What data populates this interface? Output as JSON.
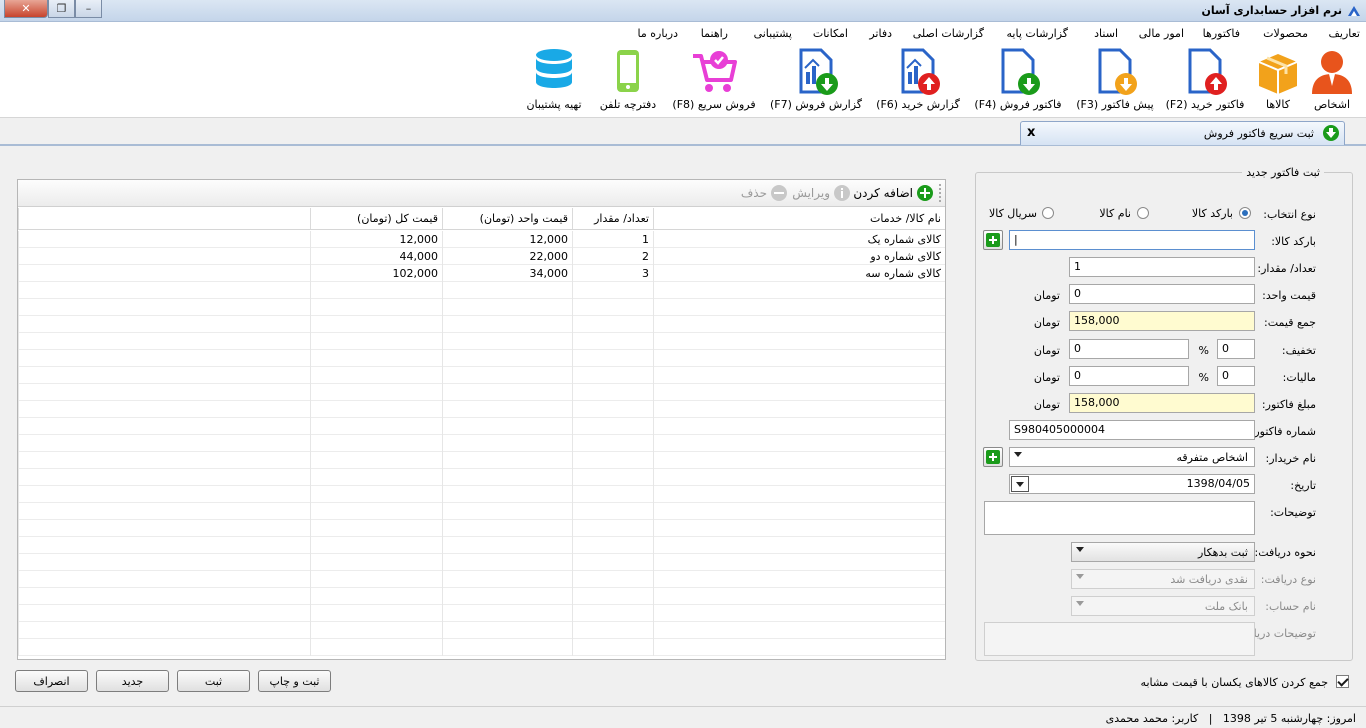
{
  "window": {
    "title": "نرم افزار حسابداری آسان"
  },
  "menu": [
    "تعاریف",
    "محصولات",
    "فاکتورها",
    "امور مالی",
    "اسناد",
    "گزارشات پایه",
    "گزارشات اصلی",
    "دفاتر",
    "امکانات",
    "پشتیبانی",
    "راهنما",
    "درباره ما"
  ],
  "toolbar": {
    "people": "اشخاص",
    "products": "کالاها",
    "purchase": "فاکتور خرید (F2)",
    "proforma": "پیش فاکتور (F3)",
    "sales": "فاکتور فروش (F4)",
    "purchase_report": "گزارش خرید (F6)",
    "sales_report": "گزارش فروش (F7)",
    "quick_sale": "فروش سریع (F8)",
    "phonebook": "دفترچه تلفن",
    "backup": "تهیه پشتیبان"
  },
  "tab": {
    "label": "ثبت سریع فاکتور فروش",
    "close": "x"
  },
  "form": {
    "group_title": "ثبت فاکتور جدید",
    "select_type_label": "نوع انتخاب:",
    "radio_barcode": "بارکد کالا",
    "radio_name": "نام کالا",
    "radio_serial": "سریال کالا",
    "barcode_label": "بارکد کالا:",
    "barcode_value": "|",
    "qty_label": "تعداد/ مقدار:",
    "qty_value": "1",
    "unit_price_label": "قیمت واحد:",
    "unit_price_value": "0",
    "total_label": "جمع قیمت:",
    "total_value": "158,000",
    "discount_label": "تخفیف:",
    "discount_pct": "0",
    "discount_value": "0",
    "tax_label": "مالیات:",
    "tax_pct": "0",
    "tax_value": "0",
    "amount_label": "مبلغ فاکتور:",
    "amount_value": "158,000",
    "invoice_no_label": "شماره فاکتور:",
    "invoice_no_value": "S980405000004",
    "buyer_label": "نام خریدار:",
    "buyer_value": "اشخاص متفرقه",
    "date_label": "تاریخ:",
    "date_value": "1398/04/05",
    "desc_label": "توضیحات:",
    "receive_method_label": "نحوه دریافت:",
    "receive_method_value": "ثبت بدهکار",
    "receive_type_label": "نوع دریافت:",
    "receive_type_value": "نقدی دریافت شد",
    "account_label": "نام حساب:",
    "account_value": "بانک ملت",
    "receive_desc_label": "توضیحات دریافت:",
    "currency": "تومان",
    "pct": "%"
  },
  "grid": {
    "add": "اضافه کردن",
    "edit": "ویرایش",
    "delete": "حذف",
    "headers": [
      "نام کالا/ خدمات",
      "تعداد/ مقدار",
      "قیمت واحد (تومان)",
      "قیمت کل (تومان)"
    ],
    "rows": [
      [
        "کالای شماره یک",
        "1",
        "12,000",
        "12,000"
      ],
      [
        "کالای شماره دو",
        "2",
        "22,000",
        "44,000"
      ],
      [
        "کالای شماره سه",
        "3",
        "34,000",
        "102,000"
      ]
    ]
  },
  "footer": {
    "merge_label": "جمع کردن کالاهای یکسان با قیمت مشابه",
    "save_print": "ثبت و چاپ",
    "save": "ثبت",
    "new": "جدید",
    "cancel": "انصراف"
  },
  "status": {
    "text": "امروز: چهارشنبه 5 تیر 1398   |   کاربر: محمد محمدی"
  },
  "colors": {
    "accent_blue": "#2a64c8",
    "green": "#1a9b1a",
    "red": "#e02020",
    "orange": "#f2a21b",
    "pink": "#e83fd6",
    "cyan": "#19a9e6",
    "yellow_field": "#fffbd0"
  }
}
